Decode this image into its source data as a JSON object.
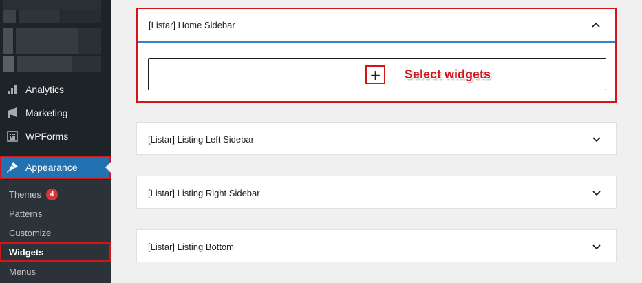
{
  "sidebar": {
    "menu": [
      {
        "label": "Analytics",
        "icon": "analytics-bar-icon"
      },
      {
        "label": "Marketing",
        "icon": "megaphone-icon"
      },
      {
        "label": "WPForms",
        "icon": "form-icon"
      },
      {
        "label": "Appearance",
        "icon": "paintbrush-icon",
        "active": true
      }
    ],
    "submenu": [
      {
        "label": "Themes",
        "badge": "4"
      },
      {
        "label": "Patterns"
      },
      {
        "label": "Customize"
      },
      {
        "label": "Widgets",
        "current": true
      },
      {
        "label": "Menus"
      }
    ]
  },
  "widget_areas": [
    {
      "title": "[Listar] Home Sidebar",
      "expanded": true
    },
    {
      "title": "[Listar] Listing Left Sidebar",
      "expanded": false
    },
    {
      "title": "[Listar] Listing Right Sidebar",
      "expanded": false
    },
    {
      "title": "[Listar] Listing Bottom",
      "expanded": false
    }
  ],
  "inserter": {
    "plus_symbol": "+",
    "annotation": "Select widgets"
  },
  "colors": {
    "admin_bar": "#1d2327",
    "submenu_bg": "#2c3338",
    "active_blue": "#2271b1",
    "highlight_red": "#d2151a",
    "badge_red": "#d63638"
  }
}
